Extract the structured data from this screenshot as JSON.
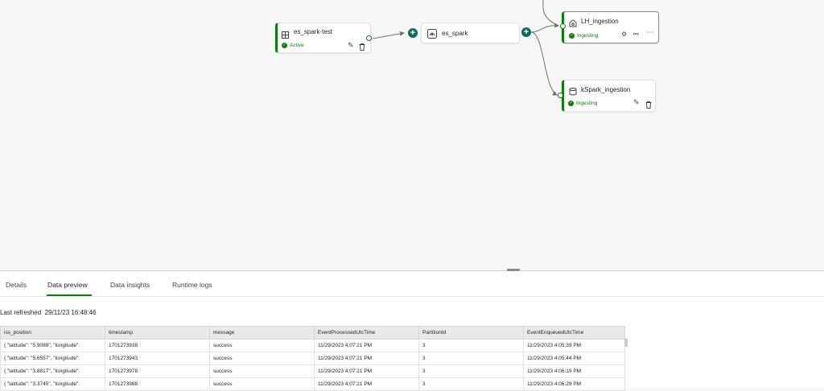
{
  "pipeline": {
    "source": {
      "name": "es_spark-test",
      "status": "Active"
    },
    "stream": {
      "name": "es_spark"
    },
    "destinations": [
      {
        "name": "LH_ingestion",
        "status": "Ingesting"
      },
      {
        "name": "kSpark_ingestion",
        "status": "Ingesting"
      }
    ]
  },
  "bottom_panel": {
    "tabs": [
      {
        "label": "Details"
      },
      {
        "label": "Data preview"
      },
      {
        "label": "Data insights"
      },
      {
        "label": "Runtime logs"
      }
    ],
    "active_tab": "Data preview",
    "last_refreshed_label": "Last refreshed",
    "last_refreshed_value": "29/11/23 16:48:46"
  },
  "table": {
    "columns": [
      "iss_position",
      "timestamp",
      "message",
      "EventProcessedUtcTime",
      "PartitionId",
      "EventEnqueuedUtcTime"
    ],
    "rows": [
      [
        "{ \"latitude\": \"5.9088\", \"longitude\":",
        "1701273938",
        "success",
        "11/29/2023 4:07:21 PM",
        "3",
        "11/29/2023 4:05:39 PM"
      ],
      [
        "{ \"latitude\": \"5.6557\", \"longitude\":",
        "1701273943",
        "success",
        "11/29/2023 4:07:21 PM",
        "3",
        "11/29/2023 4:05:44 PM"
      ],
      [
        "{ \"latitude\": \"3.8817\", \"longitude\":",
        "1701273978",
        "success",
        "11/29/2023 4:07:21 PM",
        "3",
        "11/29/2023 4:06:19 PM"
      ],
      [
        "{ \"latitude\": \"3.3745\", \"longitude\":",
        "1701273988",
        "success",
        "11/29/2023 4:07:21 PM",
        "3",
        "11/29/2023 4:06:29 PM"
      ]
    ]
  },
  "colors": {
    "accent_green": "#107c10",
    "plus_teal": "#0f6b5a"
  }
}
